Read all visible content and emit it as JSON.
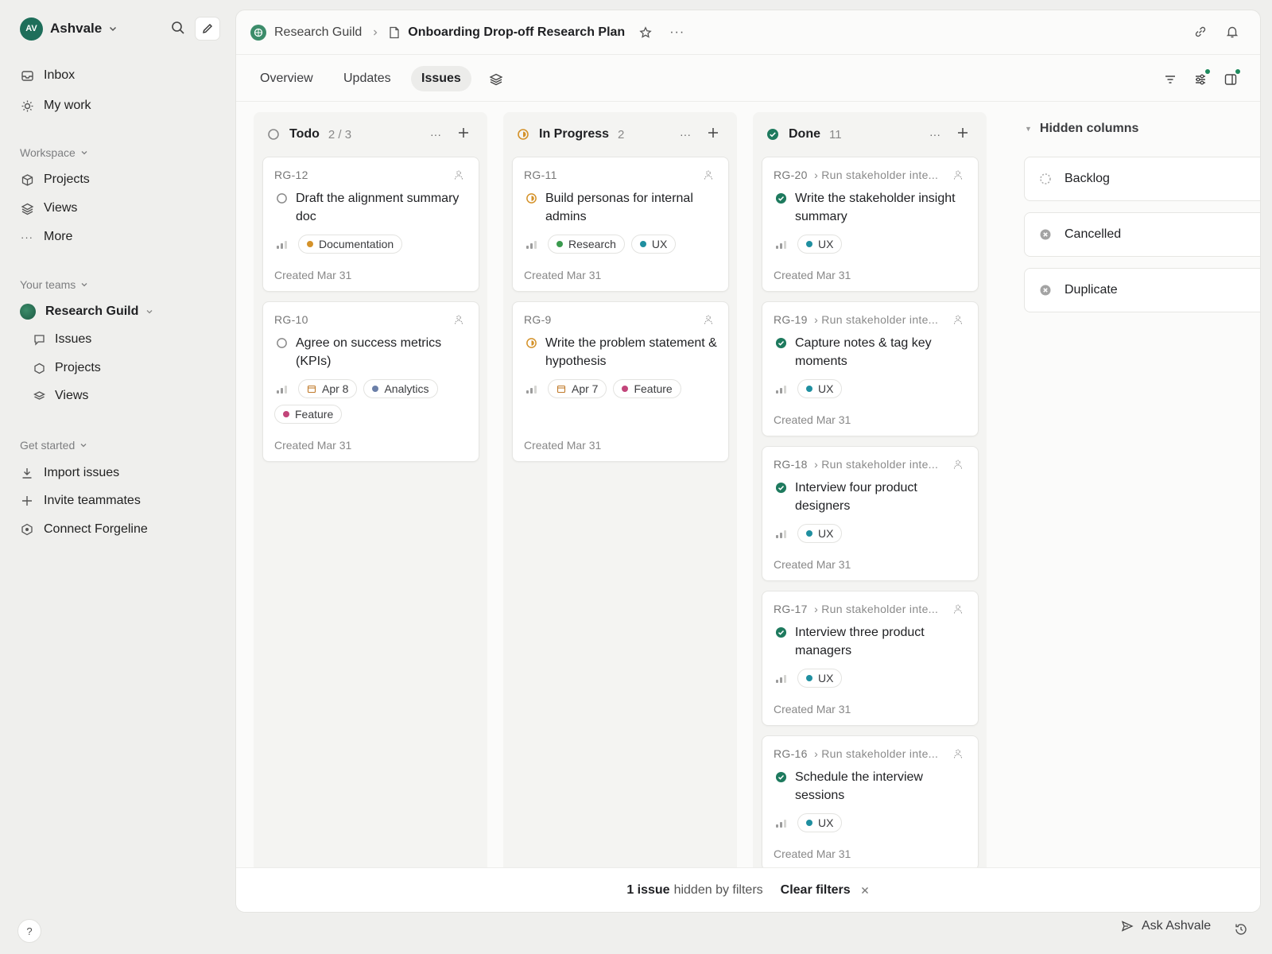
{
  "workspace": {
    "initials": "AV",
    "name": "Ashvale"
  },
  "nav": {
    "inbox": "Inbox",
    "my_work": "My work"
  },
  "workspace_section": {
    "label": "Workspace",
    "items": [
      {
        "label": "Projects"
      },
      {
        "label": "Views"
      },
      {
        "label": "More"
      }
    ]
  },
  "teams_section": {
    "label": "Your teams",
    "team": "Research Guild",
    "items": [
      {
        "label": "Issues"
      },
      {
        "label": "Projects"
      },
      {
        "label": "Views"
      }
    ]
  },
  "get_started": {
    "label": "Get started",
    "items": [
      {
        "label": "Import issues"
      },
      {
        "label": "Invite teammates"
      },
      {
        "label": "Connect Forgeline"
      }
    ]
  },
  "help": "?",
  "breadcrumb": {
    "team": "Research Guild",
    "title": "Onboarding Drop-off Research Plan",
    "more": "···"
  },
  "tabs": [
    {
      "label": "Overview"
    },
    {
      "label": "Updates"
    },
    {
      "label": "Issues",
      "active": true
    }
  ],
  "columns": [
    {
      "title": "Todo",
      "count": "2 / 3",
      "status": "todo",
      "cards": [
        {
          "id": "RG-12",
          "parent": "",
          "title": "Draft the alignment summary doc",
          "date": "",
          "labels": [
            {
              "name": "Documentation",
              "color": "#d4922a"
            }
          ],
          "created": "Created Mar 31"
        },
        {
          "id": "RG-10",
          "parent": "",
          "title": "Agree on success metrics (KPIs)",
          "date": "Apr 8",
          "labels": [
            {
              "name": "Analytics",
              "color": "#6b7fa8"
            },
            {
              "name": "Feature",
              "color": "#c2457a"
            }
          ],
          "created": "Created Mar 31"
        }
      ]
    },
    {
      "title": "In Progress",
      "count": "2",
      "status": "progress",
      "cards": [
        {
          "id": "RG-11",
          "parent": "",
          "title": "Build personas for internal admins",
          "date": "",
          "labels": [
            {
              "name": "Research",
              "color": "#3a9a4e"
            },
            {
              "name": "UX",
              "color": "#1f8fa0"
            }
          ],
          "created": "Created Mar 31"
        },
        {
          "id": "RG-9",
          "parent": "",
          "title": "Write the problem statement & hypothesis",
          "date": "Apr 7",
          "labels": [
            {
              "name": "Feature",
              "color": "#c2457a"
            }
          ],
          "created": "Created Mar 31"
        }
      ]
    },
    {
      "title": "Done",
      "count": "11",
      "status": "done",
      "cards": [
        {
          "id": "RG-20",
          "parent": "Run stakeholder inte...",
          "title": "Write the stakeholder insight summary",
          "date": "",
          "labels": [
            {
              "name": "UX",
              "color": "#1f8fa0"
            }
          ],
          "created": "Created Mar 31"
        },
        {
          "id": "RG-19",
          "parent": "Run stakeholder inte...",
          "title": "Capture notes & tag key moments",
          "date": "",
          "labels": [
            {
              "name": "UX",
              "color": "#1f8fa0"
            }
          ],
          "created": "Created Mar 31"
        },
        {
          "id": "RG-18",
          "parent": "Run stakeholder inte...",
          "title": "Interview four product designers",
          "date": "",
          "labels": [
            {
              "name": "UX",
              "color": "#1f8fa0"
            }
          ],
          "created": "Created Mar 31"
        },
        {
          "id": "RG-17",
          "parent": "Run stakeholder inte...",
          "title": "Interview three product managers",
          "date": "",
          "labels": [
            {
              "name": "UX",
              "color": "#1f8fa0"
            }
          ],
          "created": "Created Mar 31"
        },
        {
          "id": "RG-16",
          "parent": "Run stakeholder inte...",
          "title": "Schedule the interview sessions",
          "date": "",
          "labels": [
            {
              "name": "UX",
              "color": "#1f8fa0"
            }
          ],
          "created": "Created Mar 31"
        }
      ]
    }
  ],
  "hidden_columns": {
    "label": "Hidden columns",
    "items": [
      {
        "label": "Backlog",
        "status": "backlog"
      },
      {
        "label": "Cancelled",
        "status": "cancelled"
      },
      {
        "label": "Duplicate",
        "status": "duplicate"
      }
    ]
  },
  "filter_bar": {
    "count": "1 issue",
    "text": "hidden by filters",
    "clear": "Clear filters"
  },
  "assistant": {
    "label": "Ask Ashvale"
  },
  "colors": {
    "accent": "#1e6e5a",
    "done": "#1e7a5e",
    "progress": "#d4922a"
  }
}
